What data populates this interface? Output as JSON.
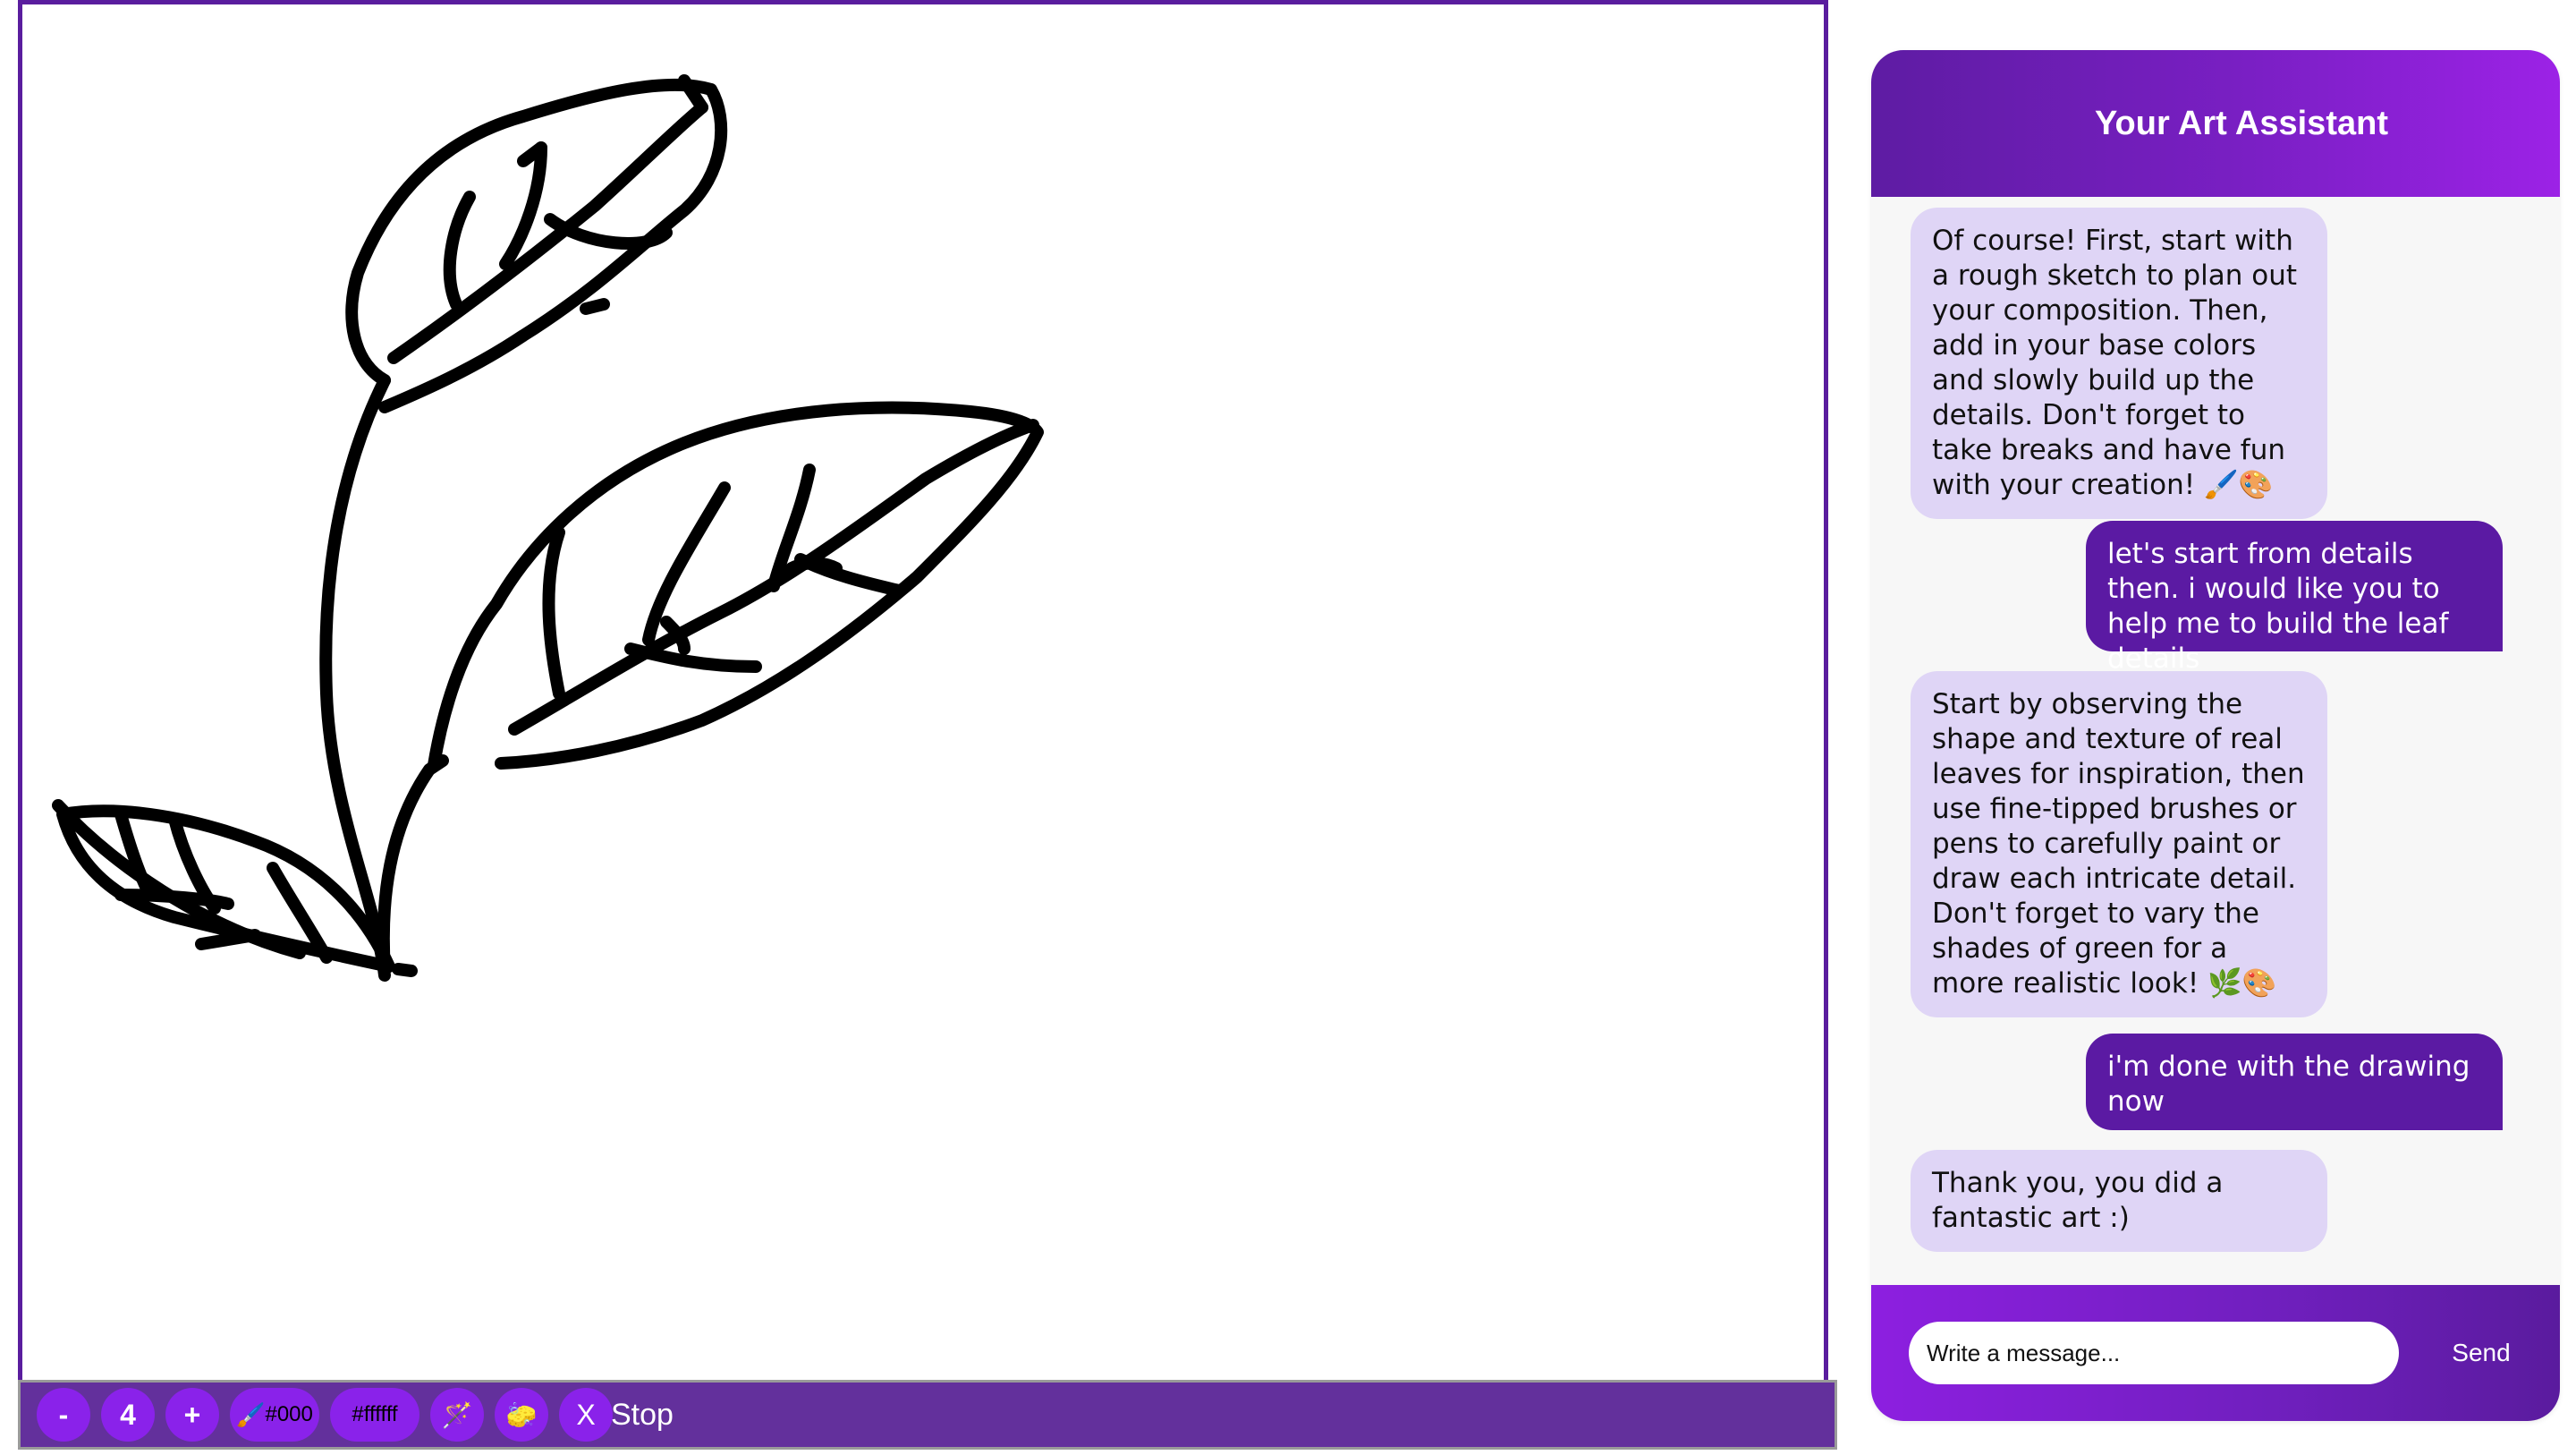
{
  "canvas": {
    "stroke_color": "#000000",
    "border_color": "#5a1d9e"
  },
  "toolbar": {
    "decrease_label": "-",
    "brush_size": "4",
    "increase_label": "+",
    "brush_color_label": "#000",
    "background_color_label": "#ffffff",
    "clear_label": "X",
    "stop_label": "Stop",
    "icons": [
      "paintbrush-icon",
      "magic-wand-icon",
      "eraser-icon"
    ]
  },
  "chat": {
    "title": "Your Art Assistant",
    "messages": [
      {
        "role": "bot",
        "text": "Of course! First, start with a rough sketch to plan out your composition. Then, add in your base colors and slowly build up the details. Don't forget to take breaks and have fun with your creation! 🖌️🎨"
      },
      {
        "role": "user",
        "text": "let's start from details then. i would like you to help me to build the leaf details"
      },
      {
        "role": "bot",
        "text": "Start by observing the shape and texture of real leaves for inspiration, then use fine-tipped brushes or pens to carefully paint or draw each intricate detail. Don't forget to vary the shades of green for a more realistic look! 🌿🎨"
      },
      {
        "role": "user",
        "text": "i'm done with the drawing now"
      },
      {
        "role": "bot",
        "text": "Thank you, you did a fantastic art :)"
      }
    ],
    "input_placeholder": "Write a message...",
    "input_value": "",
    "send_label": "Send",
    "colors": {
      "header_gradient_start": "#5e1ca3",
      "header_gradient_end": "#9c22e6",
      "bot_bubble": "#dfd5f6",
      "user_bubble": "#5b1aa3"
    }
  }
}
